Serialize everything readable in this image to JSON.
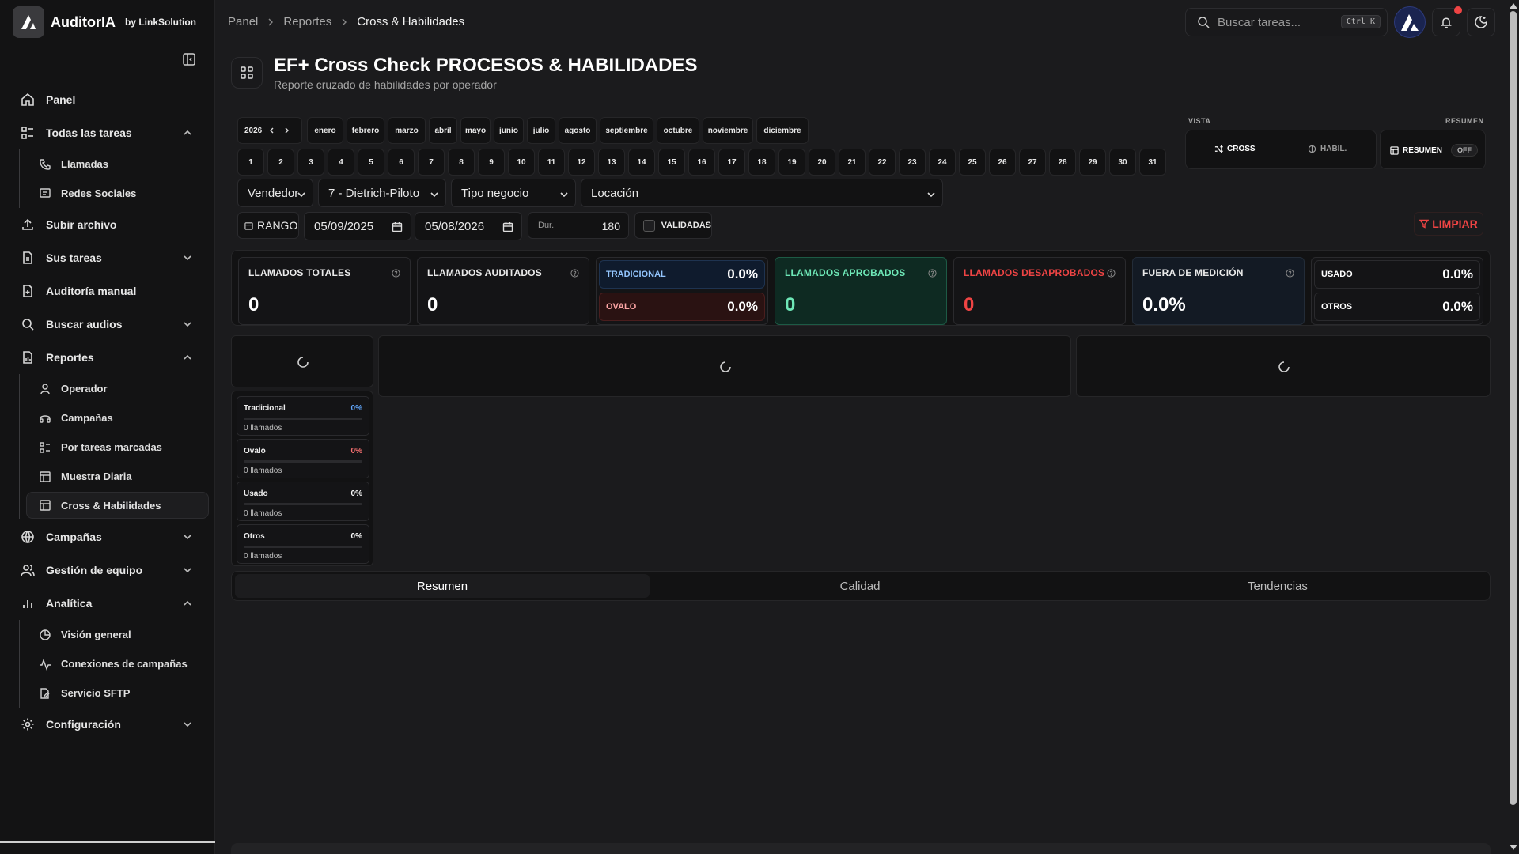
{
  "app": {
    "name": "AuditorIA",
    "by": "by LinkSolution"
  },
  "breadcrumb": [
    "Panel",
    "Reportes",
    "Cross & Habilidades"
  ],
  "search": {
    "placeholder": "Buscar tareas...",
    "shortcut": "Ctrl K"
  },
  "sidebar": {
    "panel": "Panel",
    "todas": "Todas las tareas",
    "llamadas": "Llamadas",
    "redes": "Redes Sociales",
    "subir": "Subir archivo",
    "sus_tareas": "Sus tareas",
    "auditoria": "Auditoría manual",
    "buscar_audios": "Buscar audios",
    "reportes": "Reportes",
    "operador": "Operador",
    "campanas_sub": "Campañas",
    "por_tareas": "Por tareas marcadas",
    "muestra": "Muestra Diaria",
    "cross": "Cross & Habilidades",
    "campanas": "Campañas",
    "gestion": "Gestión de equipo",
    "analitica": "Analítica",
    "vision": "Visión general",
    "conexiones": "Conexiones de campañas",
    "sftp": "Servicio SFTP",
    "config": "Configuración"
  },
  "page": {
    "title": "EF+ Cross Check PROCESOS & HABILIDADES",
    "subtitle": "Reporte cruzado de habilidades por operador"
  },
  "filters": {
    "year": "2026",
    "months": [
      "enero",
      "febrero",
      "marzo",
      "abril",
      "mayo",
      "junio",
      "julio",
      "agosto",
      "septiembre",
      "octubre",
      "noviembre",
      "diciembre"
    ],
    "days": [
      "1",
      "2",
      "3",
      "4",
      "5",
      "6",
      "7",
      "8",
      "9",
      "10",
      "11",
      "12",
      "13",
      "14",
      "15",
      "16",
      "17",
      "18",
      "19",
      "20",
      "21",
      "22",
      "23",
      "24",
      "25",
      "26",
      "27",
      "28",
      "29",
      "30",
      "31"
    ],
    "vendedor": "Vendedor",
    "team": "7 - Dietrich-Piloto",
    "tipo": "Tipo negocio",
    "locacion": "Locación",
    "rango": "RANGO",
    "date_from": "05/09/2025",
    "date_to": "05/08/2026",
    "dur_label": "Dur.",
    "dur_value": "180",
    "validadas": "VALIDADAS",
    "limpiar": "LIMPIAR"
  },
  "vista": {
    "label": "VISTA",
    "resumen_label": "RESUMEN",
    "cross": "CROSS",
    "habil": "HABIL.",
    "resumen": "RESUMEN",
    "off": "OFF"
  },
  "stats": {
    "totales_label": "LLAMADOS TOTALES",
    "totales": "0",
    "auditados_label": "LLAMADOS AUDITADOS",
    "auditados": "0",
    "tradicional_label": "TRADICIONAL",
    "tradicional": "0.0%",
    "ovalo_label": "OVALO",
    "ovalo": "0.0%",
    "aprobados_label": "LLAMADOS APROBADOS",
    "aprobados": "0",
    "desaprobados_label": "LLAMADOS DESAPROBADOS",
    "desaprobados": "0",
    "fuera_label": "FUERA DE MEDICIÓN",
    "fuera": "0.0%",
    "usado_label": "USADO",
    "usado": "0.0%",
    "otros_label": "OTROS",
    "otros": "0.0%"
  },
  "legend": [
    {
      "name": "Tradicional",
      "pct": "0%",
      "count": "0 llamados",
      "color": "#60a5fa"
    },
    {
      "name": "Ovalo",
      "pct": "0%",
      "count": "0 llamados",
      "color": "#f87171"
    },
    {
      "name": "Usado",
      "pct": "0%",
      "count": "0 llamados",
      "color": "#ffffff"
    },
    {
      "name": "Otros",
      "pct": "0%",
      "count": "0 llamados",
      "color": "#ffffff"
    }
  ],
  "tabs": [
    "Resumen",
    "Calidad",
    "Tendencias"
  ],
  "colors": {
    "accent_red": "#ef4444",
    "approved_green": "#6ee7b7",
    "tradicional_bg": "#0f1b2d",
    "ovalo_bg": "#2a1212",
    "aprobados_bg": "#0e2a22"
  }
}
